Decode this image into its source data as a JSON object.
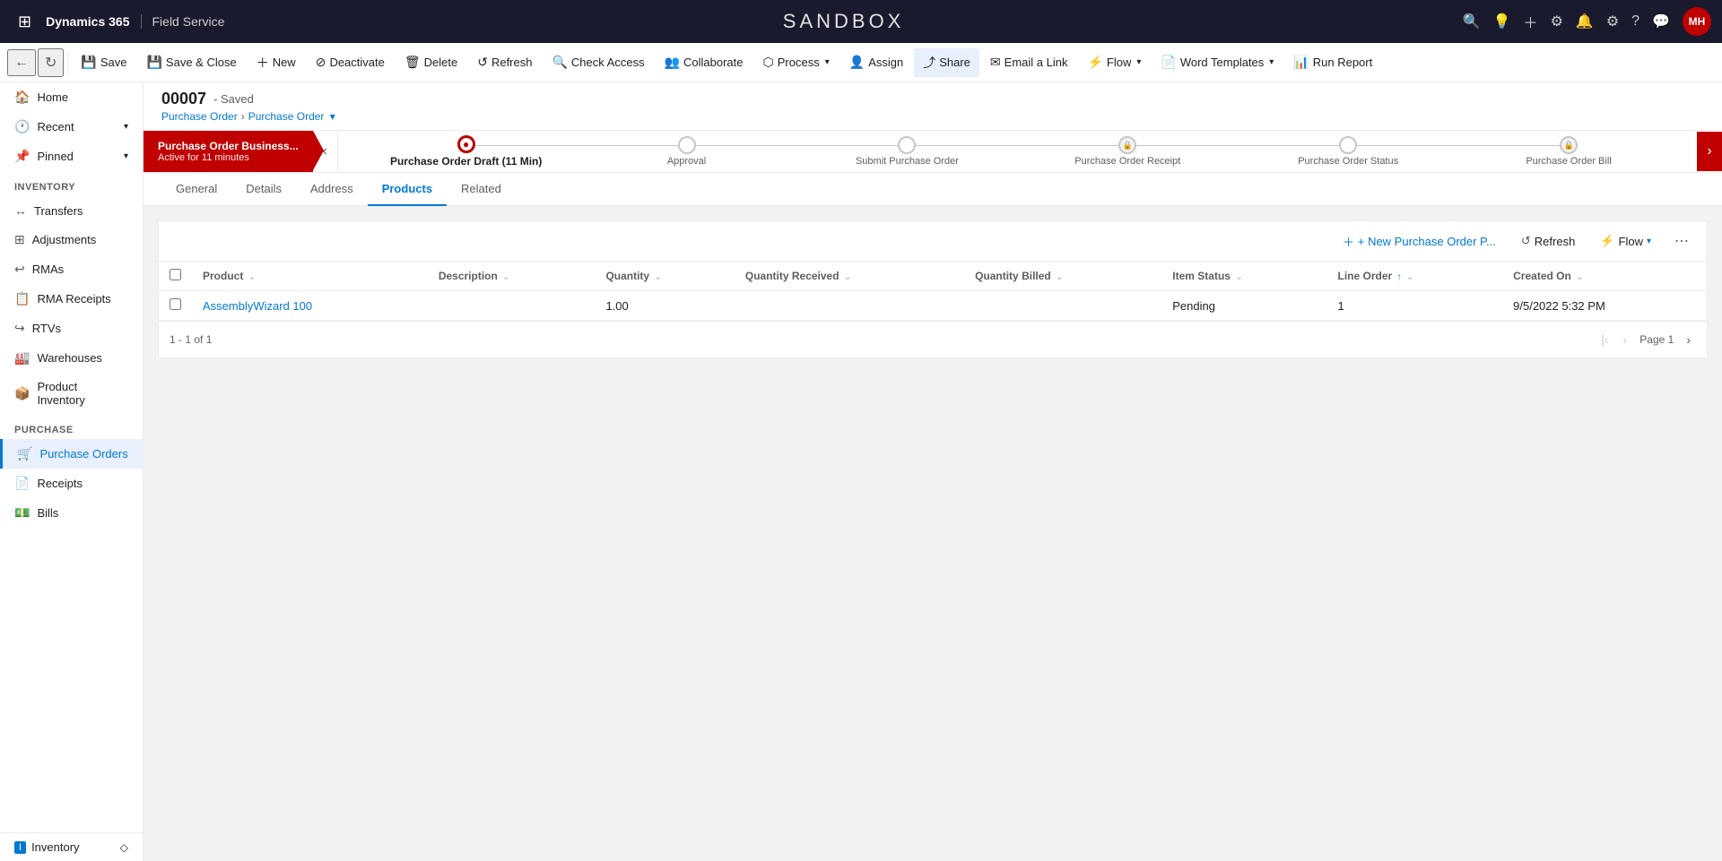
{
  "app": {
    "brand": "Dynamics 365",
    "app_name": "Field Service",
    "sandbox_title": "SANDBOX"
  },
  "top_icons": [
    "search-icon",
    "lightbulb-icon",
    "plus-icon",
    "filter-icon",
    "bell-icon",
    "gear-icon",
    "question-icon",
    "chat-icon"
  ],
  "avatar": {
    "initials": "MH",
    "bg": "#c00000"
  },
  "command_bar": {
    "back_label": "←",
    "forward_label": "↻",
    "save_label": "Save",
    "save_close_label": "Save & Close",
    "new_label": "New",
    "deactivate_label": "Deactivate",
    "delete_label": "Delete",
    "refresh_label": "Refresh",
    "check_access_label": "Check Access",
    "collaborate_label": "Collaborate",
    "process_label": "Process",
    "assign_label": "Assign",
    "share_label": "Share",
    "email_link_label": "Email a Link",
    "flow_label": "Flow",
    "word_templates_label": "Word Templates",
    "run_report_label": "Run Report"
  },
  "sidebar": {
    "top_items": [
      {
        "id": "home",
        "label": "Home",
        "icon": "🏠"
      },
      {
        "id": "recent",
        "label": "Recent",
        "icon": "🕐",
        "expandable": true
      },
      {
        "id": "pinned",
        "label": "Pinned",
        "icon": "📌",
        "expandable": true
      }
    ],
    "inventory_section": "Inventory",
    "inventory_items": [
      {
        "id": "transfers",
        "label": "Transfers",
        "icon": "↔"
      },
      {
        "id": "adjustments",
        "label": "Adjustments",
        "icon": "⊞"
      },
      {
        "id": "rmas",
        "label": "RMAs",
        "icon": "↩"
      },
      {
        "id": "rma-receipts",
        "label": "RMA Receipts",
        "icon": "📋"
      },
      {
        "id": "rtvs",
        "label": "RTVs",
        "icon": "↪"
      },
      {
        "id": "warehouses",
        "label": "Warehouses",
        "icon": "🏭"
      },
      {
        "id": "product-inventory",
        "label": "Product Inventory",
        "icon": "📦"
      }
    ],
    "purchase_section": "Purchase",
    "purchase_items": [
      {
        "id": "purchase-orders",
        "label": "Purchase Orders",
        "icon": "🛒",
        "active": true
      },
      {
        "id": "receipts",
        "label": "Receipts",
        "icon": "📄"
      },
      {
        "id": "bills",
        "label": "Bills",
        "icon": "💵"
      }
    ],
    "bottom_label": "Inventory",
    "bottom_icon": "ℹ"
  },
  "record": {
    "number": "00007",
    "status": "- Saved",
    "breadcrumb1": "Purchase Order",
    "breadcrumb2": "Purchase Order"
  },
  "process_bar": {
    "active_stage_name": "Purchase Order Business...",
    "active_stage_status": "Active for 11 minutes",
    "steps": [
      {
        "id": "draft",
        "label": "Purchase Order Draft  (11 Min)",
        "active": true,
        "locked": false
      },
      {
        "id": "approval",
        "label": "Approval",
        "active": false,
        "locked": false
      },
      {
        "id": "submit",
        "label": "Submit Purchase Order",
        "active": false,
        "locked": false
      },
      {
        "id": "receipt",
        "label": "Purchase Order Receipt",
        "active": false,
        "locked": true
      },
      {
        "id": "status",
        "label": "Purchase Order Status",
        "active": false,
        "locked": false
      },
      {
        "id": "bill",
        "label": "Purchase Order Bill",
        "active": false,
        "locked": true
      }
    ]
  },
  "tabs": [
    {
      "id": "general",
      "label": "General",
      "active": false
    },
    {
      "id": "details",
      "label": "Details",
      "active": false
    },
    {
      "id": "address",
      "label": "Address",
      "active": false
    },
    {
      "id": "products",
      "label": "Products",
      "active": true
    },
    {
      "id": "related",
      "label": "Related",
      "active": false
    }
  ],
  "grid": {
    "new_btn": "+ New Purchase Order P...",
    "refresh_btn": "Refresh",
    "flow_btn": "Flow",
    "columns": [
      {
        "id": "product",
        "label": "Product",
        "sortable": true,
        "sort": "none"
      },
      {
        "id": "description",
        "label": "Description",
        "sortable": true,
        "sort": "none"
      },
      {
        "id": "quantity",
        "label": "Quantity",
        "sortable": true,
        "sort": "none"
      },
      {
        "id": "qty-received",
        "label": "Quantity Received",
        "sortable": true,
        "sort": "none"
      },
      {
        "id": "qty-billed",
        "label": "Quantity Billed",
        "sortable": true,
        "sort": "none"
      },
      {
        "id": "item-status",
        "label": "Item Status",
        "sortable": true,
        "sort": "none"
      },
      {
        "id": "line-order",
        "label": "Line Order",
        "sortable": true,
        "sort": "asc"
      },
      {
        "id": "created-on",
        "label": "Created On",
        "sortable": true,
        "sort": "none"
      }
    ],
    "rows": [
      {
        "product": "AssemblyWizard 100",
        "description": "",
        "quantity": "1.00",
        "qty_received": "",
        "qty_billed": "",
        "item_status": "Pending",
        "line_order": "1",
        "created_on": "9/5/2022 5:32 PM"
      }
    ],
    "pagination": {
      "count": "1 - 1 of 1",
      "page_label": "Page 1"
    }
  }
}
